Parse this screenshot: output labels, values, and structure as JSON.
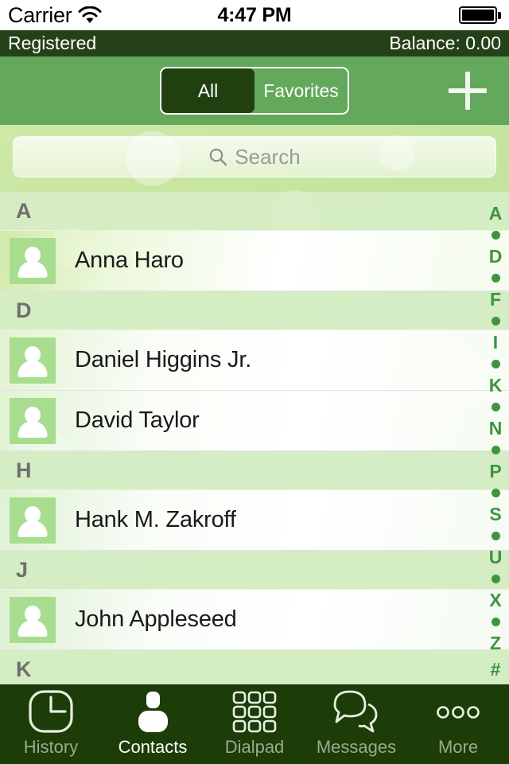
{
  "status_bar": {
    "carrier": "Carrier",
    "wifi_icon": "wifi-icon",
    "time": "4:47 PM",
    "battery_icon": "battery-full-icon"
  },
  "registration_bar": {
    "status": "Registered",
    "balance": "Balance: 0.00"
  },
  "navbar": {
    "segments": [
      {
        "label": "All",
        "selected": true
      },
      {
        "label": "Favorites",
        "selected": false
      }
    ],
    "add_button_icon": "plus-icon"
  },
  "search": {
    "icon": "search-icon",
    "placeholder": "Search",
    "value": ""
  },
  "contacts": {
    "sections": [
      {
        "letter": "A",
        "rows": [
          {
            "name": "Anna Haro",
            "avatar": "person-placeholder-icon"
          }
        ]
      },
      {
        "letter": "D",
        "rows": [
          {
            "name": "Daniel Higgins Jr.",
            "avatar": "person-placeholder-icon"
          },
          {
            "name": "David Taylor",
            "avatar": "person-placeholder-icon"
          }
        ]
      },
      {
        "letter": "H",
        "rows": [
          {
            "name": "Hank M. Zakroff",
            "avatar": "person-placeholder-icon"
          }
        ]
      },
      {
        "letter": "J",
        "rows": [
          {
            "name": "John Appleseed",
            "avatar": "person-placeholder-icon"
          }
        ]
      },
      {
        "letter": "K",
        "rows": []
      }
    ]
  },
  "alpha_index": [
    "A",
    "•",
    "D",
    "•",
    "F",
    "•",
    "I",
    "•",
    "K",
    "•",
    "N",
    "•",
    "P",
    "•",
    "S",
    "•",
    "U",
    "•",
    "X",
    "•",
    "Z",
    "#"
  ],
  "tab_bar": {
    "tabs": [
      {
        "label": "History",
        "icon": "clock-icon",
        "active": false
      },
      {
        "label": "Contacts",
        "icon": "person-icon",
        "active": true
      },
      {
        "label": "Dialpad",
        "icon": "keypad-icon",
        "active": false
      },
      {
        "label": "Messages",
        "icon": "chat-bubbles-icon",
        "active": false
      },
      {
        "label": "More",
        "icon": "ellipsis-icon",
        "active": false
      }
    ]
  },
  "colors": {
    "brand_green": "#64a85b",
    "dark_green": "#1d3d08",
    "reg_bar_green": "#25411a",
    "index_green": "#3f9440",
    "avatar_green": "#a8dd8f",
    "section_header_green": "#d7eec7"
  }
}
